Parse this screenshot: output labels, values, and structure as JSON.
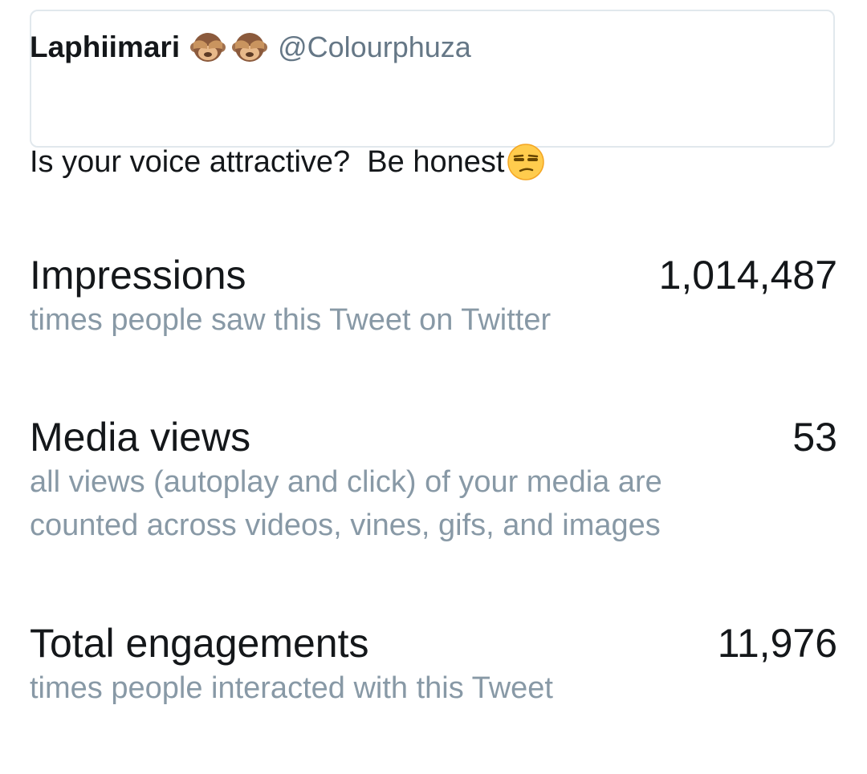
{
  "tweet": {
    "author_name": "Laphiimari",
    "author_emoji_icons": [
      "see-no-evil-monkey-icon",
      "see-no-evil-monkey-icon"
    ],
    "author_handle": "@Colourphuza",
    "text": "Is your voice attractive?  Be honest",
    "text_emoji_icon": "unamused-face-icon"
  },
  "metrics": [
    {
      "title": "Impressions",
      "value": "1,014,487",
      "description": "times people saw this Tweet on Twitter"
    },
    {
      "title": "Media views",
      "value": "53",
      "description": "all views (autoplay and click) of your media are counted across videos, vines, gifs, and images"
    },
    {
      "title": "Total engagements",
      "value": "11,976",
      "description": "times people interacted with this Tweet"
    }
  ],
  "colors": {
    "primary_text": "#14171a",
    "secondary_text": "#8899a6",
    "handle_text": "#657786",
    "card_border": "#e1e8ed"
  }
}
